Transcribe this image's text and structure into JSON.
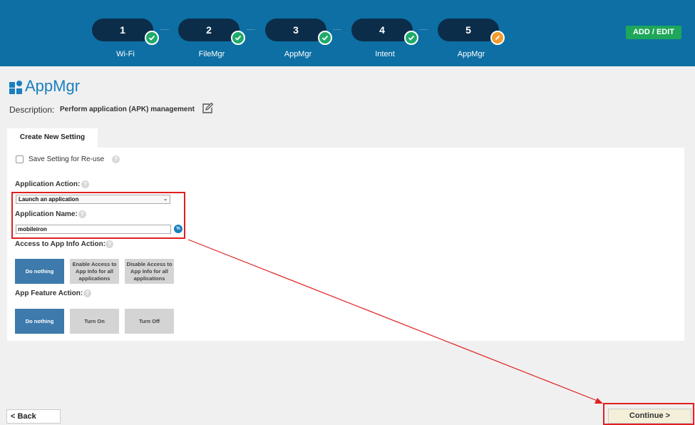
{
  "steps": [
    {
      "number": "1",
      "label": "Wi-Fi",
      "status": "done"
    },
    {
      "number": "2",
      "label": "FileMgr",
      "status": "done"
    },
    {
      "number": "3",
      "label": "AppMgr",
      "status": "done"
    },
    {
      "number": "4",
      "label": "Intent",
      "status": "done"
    },
    {
      "number": "5",
      "label": "AppMgr",
      "status": "editing"
    }
  ],
  "header": {
    "add_edit_label": "ADD / EDIT"
  },
  "page": {
    "title": "AppMgr",
    "description_label": "Description:",
    "description_value": "Perform application (APK) management"
  },
  "tab": {
    "label": "Create New Setting"
  },
  "form": {
    "save_setting_label": "Save Setting for Re-use",
    "help_glyph": "?",
    "app_action_label": "Application Action:",
    "app_action_value": "Launch an application",
    "app_action_chevron": "⌄",
    "app_name_label": "Application Name:",
    "app_name_value": "mobileiron",
    "var_button_glyph": "%",
    "info_action_label": "Access to App Info Action:",
    "info_action_options": [
      "Do nothing",
      "Enable Access to App Info for all applications",
      "Disable Access to App Info for all applications"
    ],
    "info_action_selected": "Do nothing",
    "feature_action_label": "App Feature Action:",
    "feature_action_options": [
      "Do nothing",
      "Turn On",
      "Turn Off"
    ],
    "feature_action_selected": "Do nothing"
  },
  "footer": {
    "back_label": "<  Back",
    "continue_label": "Continue   >"
  },
  "colors": {
    "header_bg": "#0d6fa3",
    "step_pill": "#0b2d49",
    "done_badge": "#1faa6b",
    "edit_badge": "#f39b2d",
    "accent": "#1a7fbf",
    "selected_option": "#3e7aab",
    "annotation_red": "#e02020"
  }
}
